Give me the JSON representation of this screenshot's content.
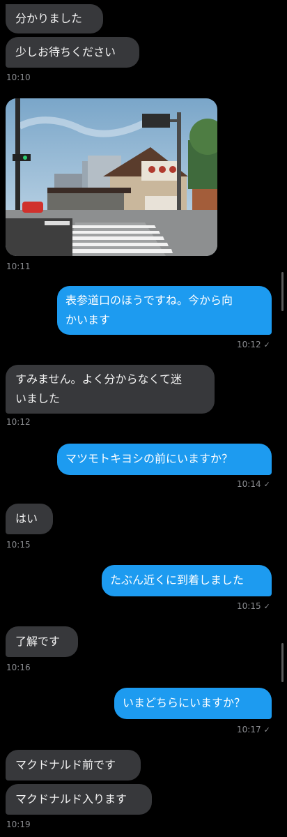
{
  "messages": [
    {
      "dir": "in",
      "text": "分かりました"
    },
    {
      "dir": "in",
      "text": "少しお待ちください",
      "time": "10:10"
    },
    {
      "dir": "in",
      "type": "photo",
      "time": "10:11"
    },
    {
      "dir": "out",
      "line1": "表参道口のほうですね。今から向",
      "line2": "かいます",
      "time": "10:12"
    },
    {
      "dir": "in",
      "line1": "すみません。よく分からなくて迷",
      "line2": "いました",
      "time": "10:12"
    },
    {
      "dir": "out",
      "text": "マツモトキヨシの前にいますか？",
      "time": "10:14"
    },
    {
      "dir": "in",
      "text": "はい",
      "time": "10:15"
    },
    {
      "dir": "out",
      "text": "たぶん近くに到着しました",
      "time": "10:15"
    },
    {
      "dir": "in",
      "text": "了解です",
      "time": "10:16"
    },
    {
      "dir": "out",
      "text": "いまどちらにいますか？",
      "time": "10:17"
    },
    {
      "dir": "in",
      "text": "マクドナルド前です"
    },
    {
      "dir": "in",
      "text": "マクドナルド入ります",
      "time": "10:19"
    }
  ],
  "read_mark": "✓",
  "colors": {
    "incoming": "#37383b",
    "outgoing": "#1d9bf0",
    "timestamp": "#8b8d91",
    "background": "#000000"
  }
}
